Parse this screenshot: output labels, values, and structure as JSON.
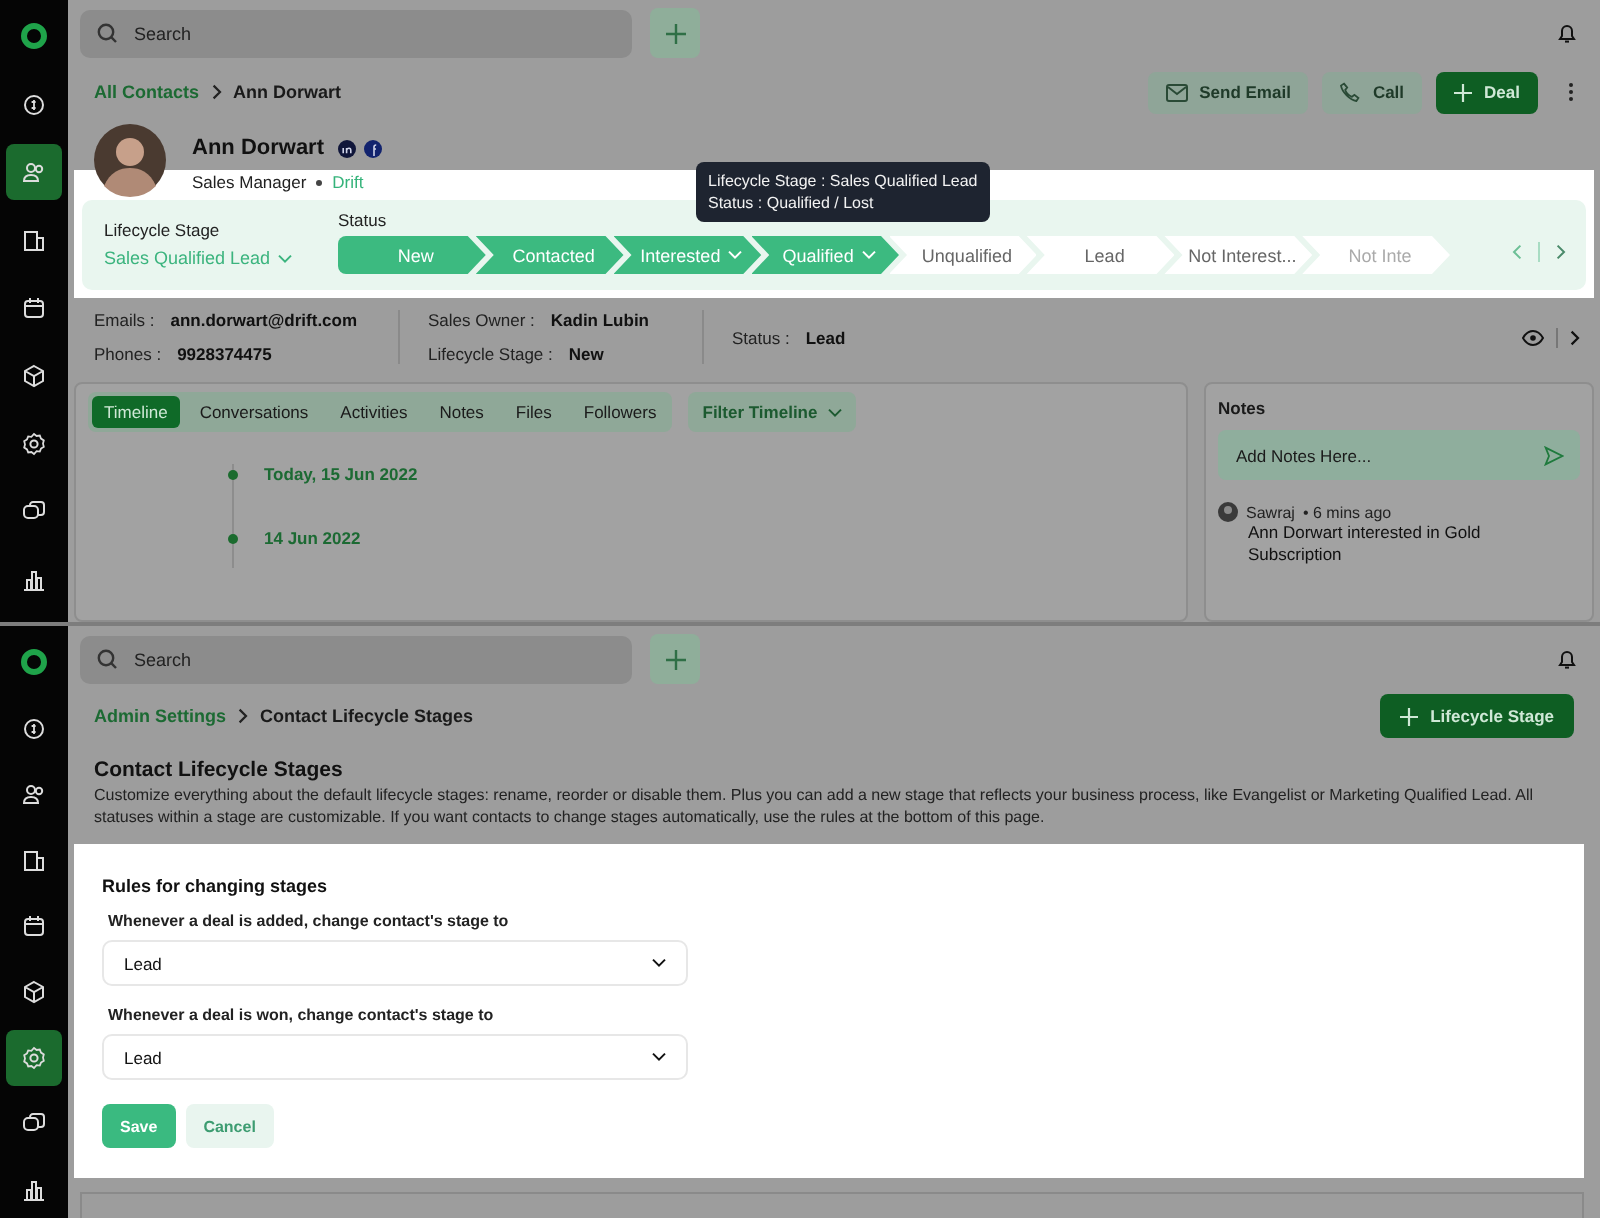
{
  "contact_screen": {
    "sidebar": [
      {
        "selected": false
      },
      {
        "selected": false
      },
      {
        "selected": true
      },
      {
        "selected": false
      },
      {
        "selected": false
      },
      {
        "selected": false
      },
      {
        "selected": false
      },
      {
        "selected": false
      },
      {
        "selected": false
      }
    ],
    "search": {
      "placeholder": "Search"
    },
    "breadcrumb": [
      "All Contacts",
      "Ann Dorwart"
    ],
    "actions": [
      {
        "label": "Send Email",
        "kind": "secondary"
      },
      {
        "label": "Call",
        "kind": "secondary"
      },
      {
        "label": "Deal",
        "kind": "primary"
      }
    ],
    "contact": {
      "name": "Ann Dorwart",
      "title": "Sales Manager",
      "company": "Drift"
    },
    "lifecycle": {
      "label": "Lifecycle Stage",
      "value": "Sales Qualified Lead",
      "status_label": "Status",
      "steps": [
        {
          "label": "New",
          "filled": true,
          "dropdown": false
        },
        {
          "label": "Contacted",
          "filled": true,
          "dropdown": false
        },
        {
          "label": "Interested",
          "filled": true,
          "dropdown": true
        },
        {
          "label": "Qualified",
          "filled": true,
          "dropdown": true
        },
        {
          "label": "Unqualified",
          "filled": false,
          "dropdown": false
        },
        {
          "label": "Lead",
          "filled": false,
          "dropdown": false
        },
        {
          "label": "Not Interest...",
          "filled": false,
          "dropdown": false
        },
        {
          "label": "Not Inte",
          "filled": false,
          "dropdown": false
        }
      ]
    },
    "tooltip": [
      "Lifecycle Stage : Sales Qualified Lead",
      "Status : Qualified / Lost"
    ],
    "details": [
      [
        {
          "label": "Emails :",
          "value": "ann.dorwart@drift.com"
        },
        {
          "label": "Phones :",
          "value": "9928374475"
        }
      ],
      [
        {
          "label": "Sales Owner :",
          "value": "Kadin Lubin"
        },
        {
          "label": "Lifecycle Stage :",
          "value": "New"
        }
      ],
      [
        {
          "label": "Status :",
          "value": "Lead"
        }
      ]
    ],
    "tabs": [
      {
        "label": "Timeline",
        "selected": true
      },
      {
        "label": "Conversations",
        "selected": false
      },
      {
        "label": "Activities",
        "selected": false
      },
      {
        "label": "Notes",
        "selected": false
      },
      {
        "label": "Files",
        "selected": false
      },
      {
        "label": "Followers",
        "selected": false
      }
    ],
    "filter": "Filter Timeline",
    "timeline": [
      "Today, 15 Jun 2022",
      "14 Jun 2022"
    ],
    "notes": {
      "title": "Notes",
      "placeholder": "Add Notes Here...",
      "items": [
        {
          "author": "Sawraj",
          "time": "• 6 mins ago",
          "text": "Ann Dorwart interested in Gold Subscription"
        }
      ]
    }
  },
  "settings_screen": {
    "sidebar": [
      {
        "selected": false
      },
      {
        "selected": false
      },
      {
        "selected": false
      },
      {
        "selected": false
      },
      {
        "selected": false
      },
      {
        "selected": false
      },
      {
        "selected": true
      },
      {
        "selected": false
      },
      {
        "selected": false
      }
    ],
    "search": {
      "placeholder": "Search"
    },
    "breadcrumb": [
      "Admin Settings",
      "Contact Lifecycle Stages"
    ],
    "add_button": "Lifecycle Stage",
    "title": "Contact Lifecycle Stages",
    "description": "Customize everything about the default lifecycle stages: rename, reorder or disable them. Plus you can add a new stage that reflects your business process, like Evangelist or Marketing Qualified Lead. All statuses within a stage are customizable. If you want contacts to change stages automatically, use the rules at the bottom of this page.",
    "rules": {
      "title": "Rules for changing stages",
      "fields": [
        {
          "label": "Whenever a deal is added, change contact's stage to",
          "value": "Lead"
        },
        {
          "label": "Whenever a deal is won, change contact's stage to",
          "value": "Lead"
        }
      ],
      "buttons": [
        {
          "label": "Save",
          "kind": "primary"
        },
        {
          "label": "Cancel",
          "kind": "secondary"
        }
      ]
    }
  }
}
